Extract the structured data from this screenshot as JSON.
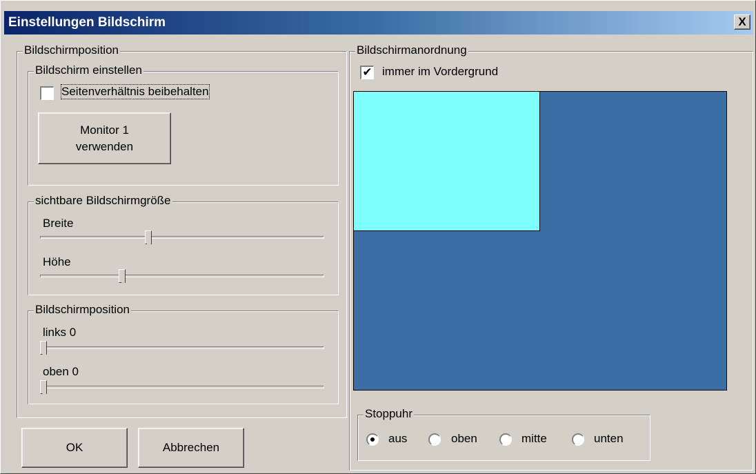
{
  "window": {
    "title": "Einstellungen Bildschirm",
    "close_label": "X"
  },
  "left_group": {
    "title": "Bildschirmposition",
    "setup": {
      "title": "Bildschirm einstellen",
      "keep_aspect_label": "Seitenverhältnis beibehalten",
      "keep_aspect_checked": false,
      "monitor_button_line1": "Monitor 1",
      "monitor_button_line2": "verwenden"
    },
    "visible_size": {
      "title": "sichtbare Bildschirmgröße",
      "width_label": "Breite",
      "width_value": 0.38,
      "height_label": "Höhe",
      "height_value": 0.29
    },
    "position": {
      "title": "Bildschirmposition",
      "left_label": "links 0",
      "left_value": 0.0,
      "top_label": "oben 0",
      "top_value": 0.0
    }
  },
  "right_group": {
    "title": "Bildschirmanordnung",
    "always_on_top_label": "immer im Vordergrund",
    "always_on_top_checked": true,
    "colors": {
      "screen_area": "#3a6ea5",
      "window_area": "#80ffff"
    }
  },
  "stopwatch": {
    "title": "Stoppuhr",
    "options": [
      "aus",
      "oben",
      "mitte",
      "unten"
    ],
    "selected": "aus"
  },
  "buttons": {
    "ok_label": "OK",
    "cancel_label": "Abbrechen"
  }
}
